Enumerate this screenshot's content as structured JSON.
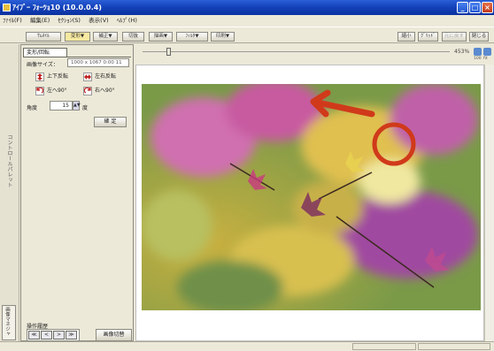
{
  "window": {
    "title": "ｱｲﾌﾞｰ ﾌｫｰﾂｮ10 (10.0.0.4)"
  },
  "menu": [
    "ﾌｧｲﾙ(F)",
    "編集(E)",
    "ｾｸｼｮﾝ(S)",
    "表示(V)",
    "ﾍﾙﾌﾟ(H)"
  ],
  "toolbar": {
    "thumbnail": "ｻﾑﾈｲﾙ",
    "transform": "変形▼",
    "correct": "補正▼",
    "crop": "切抜",
    "paint": "描画▼",
    "filter": "ﾌｨﾙﾀ▼",
    "print": "印刷▼",
    "right1": "縮小",
    "right2": "ｸﾞﾘｯﾄﾞ",
    "right3": "元に戻す",
    "right4": "閉じる"
  },
  "sidebar": {
    "label": "コントロールパレット",
    "tab_label": "画像マネジャ"
  },
  "panel": {
    "tab": "変形/回転",
    "size_label": "画像サイズ：",
    "size_value": "1000 x 1067 0:00 11",
    "flip_vertical": "上下反転",
    "flip_horizontal": "左右反転",
    "rotate_left": "左へ90°",
    "rotate_right": "右へ90°",
    "angle_label": "角度",
    "angle_value": "15",
    "angle_unit": "度",
    "apply": "確 定",
    "history_label": "操作履歴",
    "nav_first": "≪",
    "nav_prev": "<",
    "nav_next": ">",
    "nav_last": "≫",
    "memo_button": "画像切替"
  },
  "zoom": {
    "label": "453%",
    "btn1_label": "100",
    "btn2_label": "fit"
  },
  "annotation": {
    "arrow_color": "#d03a1a",
    "circle_color": "#d03a1a"
  }
}
